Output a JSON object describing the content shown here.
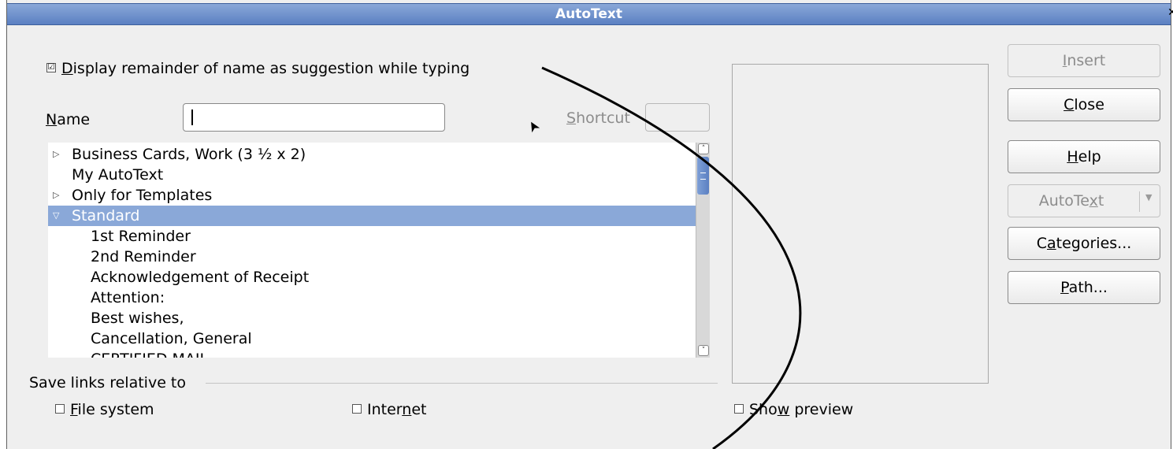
{
  "title": "AutoText",
  "display_remainder": {
    "checked": true,
    "check_glyph": "☑",
    "label_underlined": "D",
    "label_rest": "isplay remainder of name as suggestion while typing"
  },
  "name_field": {
    "label_underlined": "N",
    "label_rest": "ame",
    "value": ""
  },
  "shortcut_field": {
    "label_underlined": "S",
    "label_rest": "hortcut",
    "value": ""
  },
  "tree": {
    "items": [
      {
        "expander": "▷",
        "label": "Business Cards, Work (3 ½ x 2)",
        "indent": 0,
        "selected": false
      },
      {
        "expander": "",
        "label": "My AutoText",
        "indent": 0,
        "selected": false
      },
      {
        "expander": "▷",
        "label": "Only for Templates",
        "indent": 0,
        "selected": false
      },
      {
        "expander": "▽",
        "label": "Standard",
        "indent": 0,
        "selected": true
      },
      {
        "expander": "",
        "label": "1st Reminder",
        "indent": 1,
        "selected": false
      },
      {
        "expander": "",
        "label": "2nd Reminder",
        "indent": 1,
        "selected": false
      },
      {
        "expander": "",
        "label": "Acknowledgement of Receipt",
        "indent": 1,
        "selected": false
      },
      {
        "expander": "",
        "label": "Attention:",
        "indent": 1,
        "selected": false
      },
      {
        "expander": "",
        "label": "Best wishes,",
        "indent": 1,
        "selected": false
      },
      {
        "expander": "",
        "label": "Cancellation, General",
        "indent": 1,
        "selected": false
      },
      {
        "expander": "",
        "label": "CERTIFIED MAIL",
        "indent": 1,
        "selected": false
      }
    ],
    "scroll_up_glyph": "˄",
    "scroll_down_glyph": "˅"
  },
  "save_links": {
    "heading": "Save links relative to",
    "file_system": {
      "checked": false,
      "glyph": "☐",
      "label_underlined": "F",
      "label_rest": "ile system"
    },
    "internet": {
      "checked": false,
      "glyph": "☐",
      "label_pre": "Inter",
      "label_underlined": "n",
      "label_rest": "et"
    }
  },
  "show_preview": {
    "checked": false,
    "glyph": "☐",
    "label_pre": "Sho",
    "label_underlined": "w",
    "label_rest": " preview"
  },
  "buttons": {
    "insert": {
      "underlined": "I",
      "rest": "nsert",
      "enabled": false
    },
    "close": {
      "underlined": "C",
      "rest": "lose",
      "enabled": true
    },
    "help": {
      "underlined": "H",
      "rest": "elp",
      "enabled": true
    },
    "autotext": {
      "pre": "AutoTe",
      "underlined": "x",
      "rest": "t",
      "enabled": false,
      "arrow": "▼"
    },
    "categories": {
      "pre": "C",
      "underlined": "a",
      "rest": "tegories...",
      "enabled": true
    },
    "path": {
      "underlined": "P",
      "rest": "ath...",
      "enabled": true
    }
  },
  "title_close_glyph": "✕",
  "mouse_cursor_glyph": "➤"
}
